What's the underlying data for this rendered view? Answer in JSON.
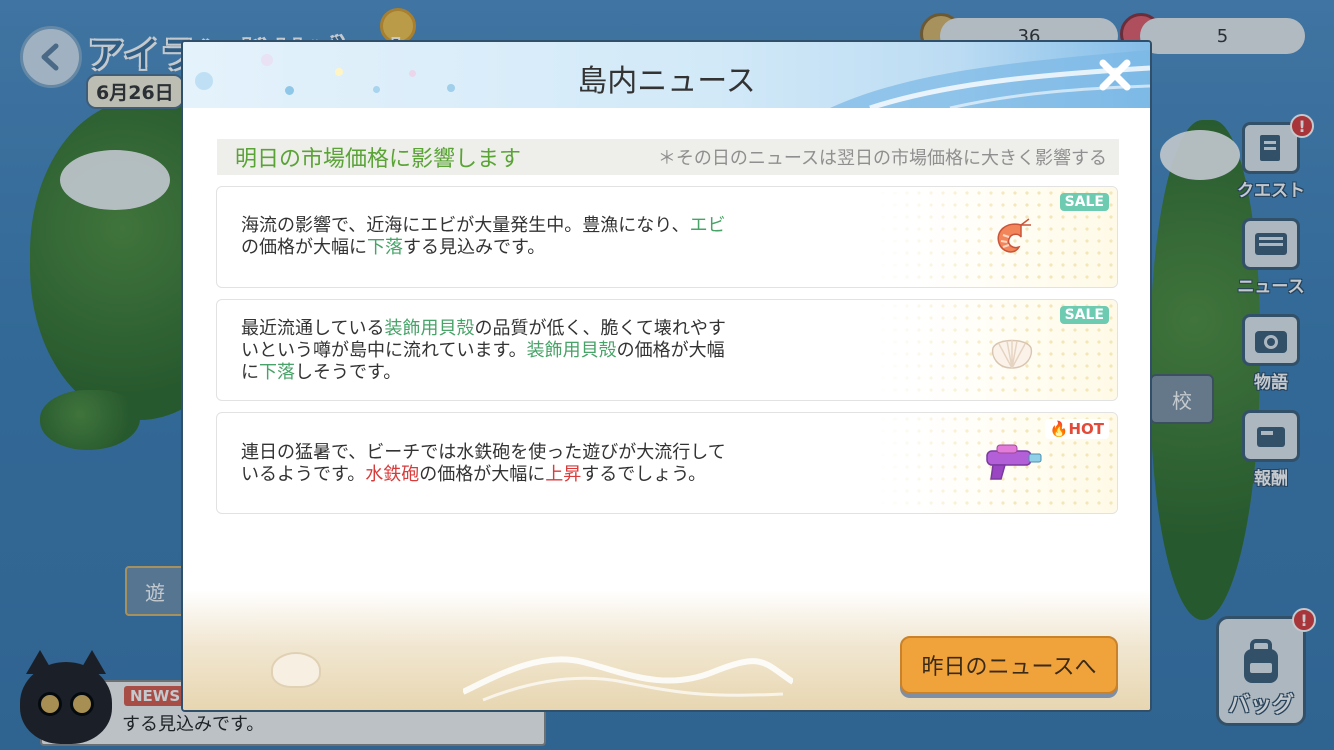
{
  "background": {
    "island_name": "アイランドリゾート",
    "date": "6月26日",
    "resources": [
      {
        "icon": "coin-icon",
        "value": "36"
      },
      {
        "icon": "fruit-icon",
        "value": "5"
      }
    ],
    "side_menu": [
      {
        "label": "クエスト",
        "icon": "quest-icon",
        "alert": "!"
      },
      {
        "label": "ニュース",
        "icon": "news-icon",
        "alert": ""
      },
      {
        "label": "物語",
        "icon": "camera-icon",
        "alert": ""
      },
      {
        "label": "報酬",
        "icon": "reward-icon",
        "alert": ""
      }
    ],
    "bag": {
      "label": "バッグ",
      "alert": "!"
    },
    "school_label": "校",
    "left_box_label": "遊",
    "ticker": {
      "tag": "NEWS",
      "text": "する見込みです。"
    }
  },
  "modal": {
    "title": "島内ニュース",
    "headline": "明日の市場価格に影響します",
    "note": "＊その日のニュースは翌日の市場価格に大きく影響する",
    "items": [
      {
        "tag": "SALE",
        "item_icon": "shrimp-icon",
        "line1_a": "海流の影響で、近海にエビが大量発生中。豊漁になり、",
        "line1_b": "エビ",
        "line2_a": "の価格が大幅に",
        "line2_b": "下落",
        "line2_c": "する見込みです。"
      },
      {
        "tag": "SALE",
        "item_icon": "shell-icon",
        "line1_a": "最近流通している",
        "line1_b": "装飾用貝殻",
        "line1_c": "の品質が低く、脆くて壊れやす",
        "line2_a": "いという噂が島中に流れています。",
        "line2_b": "装飾用貝殻",
        "line2_c": "の価格が大幅",
        "line3_a": "に",
        "line3_b": "下落",
        "line3_c": "しそうです。"
      },
      {
        "tag": "HOT",
        "item_icon": "water-gun-icon",
        "line1_a": "連日の猛暑で、ビーチでは水鉄砲を使った遊びが大流行して",
        "line2_a": "いるようです。",
        "line2_b": "水鉄砲",
        "line2_c": "の価格が大幅に",
        "line2_d": "上昇",
        "line2_e": "するでしょう。"
      }
    ],
    "prev_button": "昨日のニュースへ"
  },
  "colors": {
    "highlight_green": "#47a368",
    "highlight_red": "#d93a3a",
    "headline_green": "#5aa436",
    "button_orange": "#f0a23b"
  }
}
